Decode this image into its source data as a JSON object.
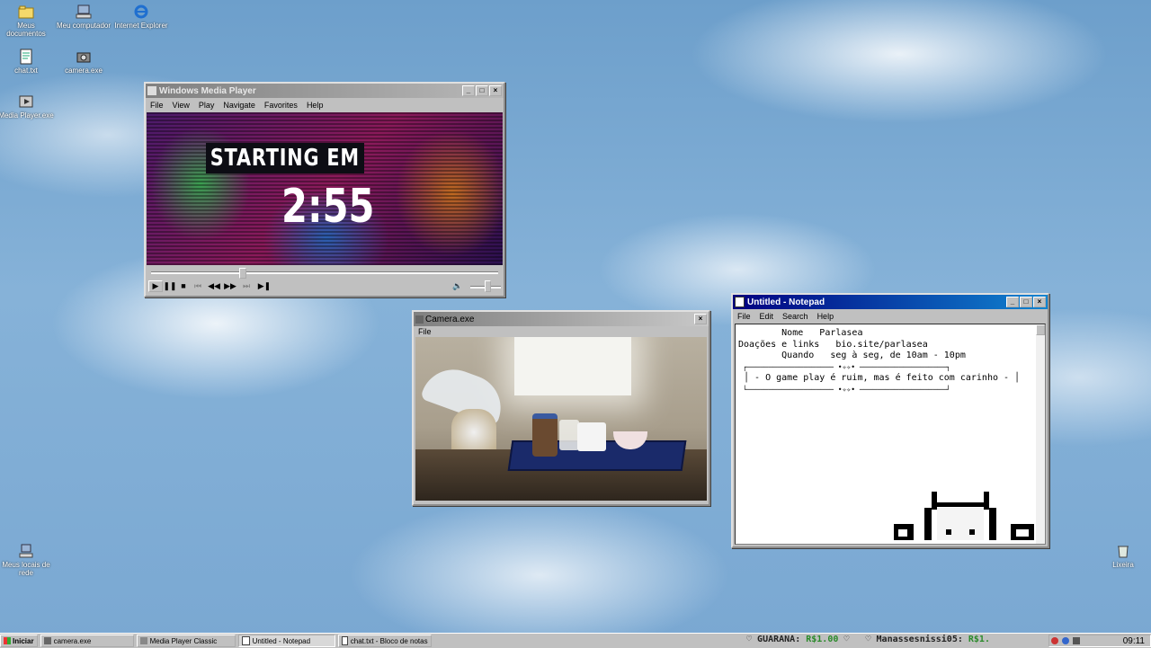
{
  "desktop": {
    "icons": [
      {
        "label": "Meus documentos",
        "icon": "folder-icon"
      },
      {
        "label": "Meu computador",
        "icon": "computer-icon"
      },
      {
        "label": "Internet Explorer",
        "icon": "internet-explorer-icon"
      },
      {
        "label": "chat.txt",
        "icon": "text-file-icon"
      },
      {
        "label": "camera.exe",
        "icon": "camera-icon"
      },
      {
        "label": "Media Player.exe",
        "icon": "media-player-icon"
      },
      {
        "label": "Meus locais de rede",
        "icon": "network-icon"
      },
      {
        "label": "Lixeira",
        "icon": "recycle-bin-icon"
      }
    ]
  },
  "media_player": {
    "title": "Windows Media Player",
    "menu": [
      "File",
      "View",
      "Play",
      "Navigate",
      "Favorites",
      "Help"
    ],
    "video_line1": "STARTING EM",
    "video_line2": "2:55",
    "seek_progress": 0.26,
    "volume_level": 0.6
  },
  "camera": {
    "title": "Camera.exe",
    "menu": [
      "File"
    ]
  },
  "notepad": {
    "title": "Untitled - Notepad",
    "menu": [
      "File",
      "Edit",
      "Search",
      "Help"
    ],
    "lines": [
      "        Nome   Parlasea",
      "",
      "Doações e links   bio.site/parlasea",
      "",
      "        Quando   seg à seg, de 10am - 10pm",
      "",
      "",
      " ┌──────────────────── •✧✧• ────────────────────┐",
      " │ - O game play é ruim, mas é feito com carinho - │",
      " └──────────────────── •✧✧• ────────────────────┘"
    ]
  },
  "taskbar": {
    "start": "Iniciar",
    "buttons": [
      "camera.exe",
      "Media Player Classic",
      "Untitled - Notepad",
      "chat.txt - Bloco de notas"
    ],
    "ticker1_name": "GUARANÁ:",
    "ticker1_value": "R$1.00",
    "ticker2_name": "Manassesnissi05:",
    "ticker2_value": "R$1.",
    "clock": "09:11"
  },
  "colors": {
    "title_active": "#000080",
    "title_inactive": "#808080",
    "ticker_value": "#2a8a2a"
  }
}
